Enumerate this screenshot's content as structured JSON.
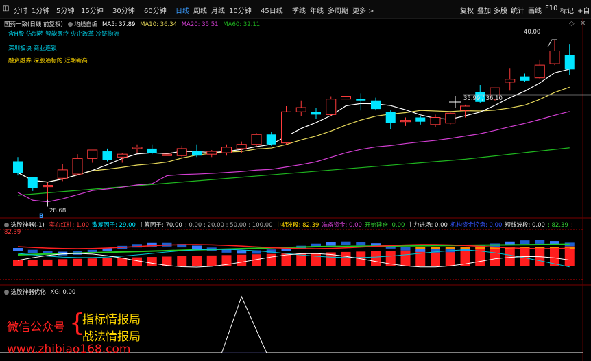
{
  "toolbar": {
    "tabs": [
      "分时",
      "1分钟",
      "5分钟",
      "15分钟",
      "30分钟",
      "60分钟",
      "日线",
      "周线",
      "月线",
      "10分钟",
      "45日线",
      "季线",
      "年线",
      "多周期",
      "更多 >"
    ],
    "active_tab": "日线",
    "right_buttons": [
      "复权",
      "叠加",
      "多股",
      "统计",
      "画线",
      "F10",
      "标记"
    ],
    "overflow": "+自"
  },
  "main_pane": {
    "title": "国药一致(日线 前复权)",
    "indicator_name": "均线自编",
    "ma5": "MA5: 37.89",
    "ma10": "MA10: 36.34",
    "ma20": "MA20: 35.51",
    "ma60": "MA60: 32.11",
    "tags_line1": "含H股 仿制药 智能医疗 央企改革 冷链物流",
    "tags_line2": "深圳板块 商业连锁",
    "tags_line3": "融资融券 深股通标的 近期新高",
    "high_label": "40.00",
    "low_label": "28.68",
    "cursor_label": "35.99 / 36.10",
    "marker": "B",
    "colors": {
      "ma5": "#ffffff",
      "ma10": "#e6d85a",
      "ma20": "#d33fd3",
      "ma60": "#1fb61f",
      "up": "#ff3b3b",
      "down": "#00e5ff"
    }
  },
  "chart_data": {
    "type": "candlestick",
    "ylim": [
      27.5,
      41.5
    ],
    "candles": [
      {
        "o": 31.4,
        "h": 31.7,
        "l": 30.4,
        "c": 30.6
      },
      {
        "o": 30.3,
        "h": 30.3,
        "l": 29.3,
        "c": 29.5
      },
      {
        "o": 29.6,
        "h": 29.9,
        "l": 28.68,
        "c": 29.7
      },
      {
        "o": 30.2,
        "h": 31.2,
        "l": 30.0,
        "c": 30.8
      },
      {
        "o": 30.5,
        "h": 31.9,
        "l": 30.4,
        "c": 31.6
      },
      {
        "o": 31.6,
        "h": 32.2,
        "l": 31.3,
        "c": 32.2
      },
      {
        "o": 32.1,
        "h": 32.3,
        "l": 31.4,
        "c": 31.5
      },
      {
        "o": 31.7,
        "h": 32.0,
        "l": 31.3,
        "c": 31.9
      },
      {
        "o": 32.3,
        "h": 32.6,
        "l": 32.0,
        "c": 32.4
      },
      {
        "o": 32.3,
        "h": 32.6,
        "l": 31.9,
        "c": 32.0
      },
      {
        "o": 31.8,
        "h": 32.0,
        "l": 31.6,
        "c": 31.9
      },
      {
        "o": 31.8,
        "h": 32.5,
        "l": 31.6,
        "c": 32.3
      },
      {
        "o": 32.1,
        "h": 32.6,
        "l": 31.7,
        "c": 31.8
      },
      {
        "o": 31.9,
        "h": 32.2,
        "l": 31.7,
        "c": 32.1
      },
      {
        "o": 32.0,
        "h": 32.6,
        "l": 31.8,
        "c": 32.4
      },
      {
        "o": 32.3,
        "h": 32.8,
        "l": 32.0,
        "c": 32.6
      },
      {
        "o": 32.6,
        "h": 33.4,
        "l": 32.4,
        "c": 33.3
      },
      {
        "o": 33.3,
        "h": 33.5,
        "l": 32.5,
        "c": 32.6
      },
      {
        "o": 32.7,
        "h": 35.3,
        "l": 32.6,
        "c": 34.9
      },
      {
        "o": 34.9,
        "h": 35.7,
        "l": 34.6,
        "c": 35.2
      },
      {
        "o": 34.9,
        "h": 35.2,
        "l": 34.4,
        "c": 34.7
      },
      {
        "o": 34.7,
        "h": 36.0,
        "l": 34.6,
        "c": 35.8
      },
      {
        "o": 35.8,
        "h": 36.4,
        "l": 35.6,
        "c": 36.0
      },
      {
        "o": 35.8,
        "h": 36.2,
        "l": 35.0,
        "c": 35.7
      },
      {
        "o": 35.7,
        "h": 35.9,
        "l": 35.0,
        "c": 35.1
      },
      {
        "o": 34.9,
        "h": 35.0,
        "l": 33.7,
        "c": 34.1
      },
      {
        "o": 34.2,
        "h": 34.5,
        "l": 33.9,
        "c": 34.3
      },
      {
        "o": 34.5,
        "h": 34.6,
        "l": 34.0,
        "c": 34.2
      },
      {
        "o": 34.0,
        "h": 34.7,
        "l": 33.8,
        "c": 34.5
      },
      {
        "o": 34.1,
        "h": 34.9,
        "l": 34.0,
        "c": 34.8
      },
      {
        "o": 35.0,
        "h": 35.4,
        "l": 34.5,
        "c": 35.3
      },
      {
        "o": 36.3,
        "h": 36.8,
        "l": 35.5,
        "c": 35.6
      },
      {
        "o": 35.8,
        "h": 36.6,
        "l": 35.7,
        "c": 36.6
      },
      {
        "o": 37.0,
        "h": 38.0,
        "l": 36.4,
        "c": 37.2
      },
      {
        "o": 37.4,
        "h": 37.6,
        "l": 37.0,
        "c": 37.1
      },
      {
        "o": 37.3,
        "h": 38.6,
        "l": 37.2,
        "c": 38.2
      },
      {
        "o": 38.3,
        "h": 40.0,
        "l": 38.2,
        "c": 39.2
      },
      {
        "o": 38.9,
        "h": 39.7,
        "l": 37.5,
        "c": 37.9
      }
    ]
  },
  "sub_pane1": {
    "name": "选股神器(-1)",
    "items": [
      {
        "label": "实心红柱: 1.00",
        "color": "#ff3b3b"
      },
      {
        "label": "散筹因子: 29.00",
        "color": "#00e5ff"
      },
      {
        "label": "主筹因子: 70.00",
        "color": "#e0e0e0"
      },
      {
        "label": ": 0.00 : 20.00 : 50.00 : 100.00",
        "color": "#aaaaaa"
      },
      {
        "label": "中期波段: 82.39",
        "color": "#ffd700"
      },
      {
        "label": "准备资金: 0.00",
        "color": "#d33fd3"
      },
      {
        "label": "开始建仓: 0.00",
        "color": "#32cd32"
      },
      {
        "label": "主力进场: 0.00",
        "color": "#e0e0e0"
      },
      {
        "label": "机构资金控盘: 0.00",
        "color": "#3355ff"
      },
      {
        "label": "短线波段: 0.00",
        "color": "#e0e0e0"
      },
      {
        "label": ": 82.39",
        "color": "#32cd32"
      },
      {
        "label": ": 82.39",
        "color": "#ff3b3b"
      }
    ]
  },
  "sub_pane2": {
    "name": "选股神器优化",
    "xg": "XG: 0.00"
  },
  "watermark": {
    "left": "微信公众号",
    "line1": "指标情报局",
    "line2": "战法情报局",
    "url": "www.zhibiao168.com"
  }
}
